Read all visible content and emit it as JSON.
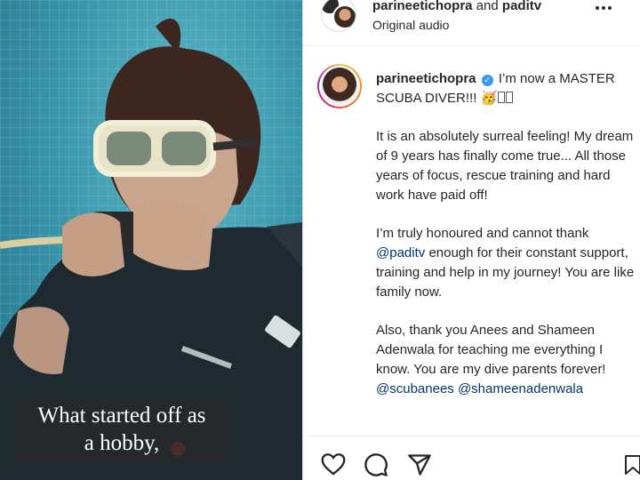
{
  "media": {
    "caption_line1": "What started off as",
    "caption_line2": "a hobby,"
  },
  "header": {
    "username": "parineetichopra",
    "conjunction": "and",
    "collaborator": "paditv",
    "audio": "Original audio"
  },
  "post": {
    "author": "parineetichopra",
    "headline": "I’m now a MASTER SCUBA DIVER!!!",
    "emoji": "🥳",
    "paragraph1": "It is an absolutely surreal feeling! My dream of 9 years has finally come true... All those years of focus, rescue training and hard work have paid off!",
    "paragraph2_text": "I’m truly honoured and cannot thank",
    "paragraph2_mention": "@paditv",
    "paragraph2_rest": "enough for their constant support, training and help in my journey! You are like family now.",
    "paragraph3_text": "Also, thank you Anees and Shameen Adenwala for teaching me everything I know. You are my dive parents forever!",
    "mention1": "@scubanees",
    "mention2": "@shameenadenwala"
  },
  "colors": {
    "verified": "#3897f0",
    "mention": "#00376b",
    "water": "#3c98ad"
  },
  "icons": [
    "heart-icon",
    "comment-icon",
    "share-icon",
    "bookmark-icon",
    "more-icon",
    "verified-icon"
  ]
}
